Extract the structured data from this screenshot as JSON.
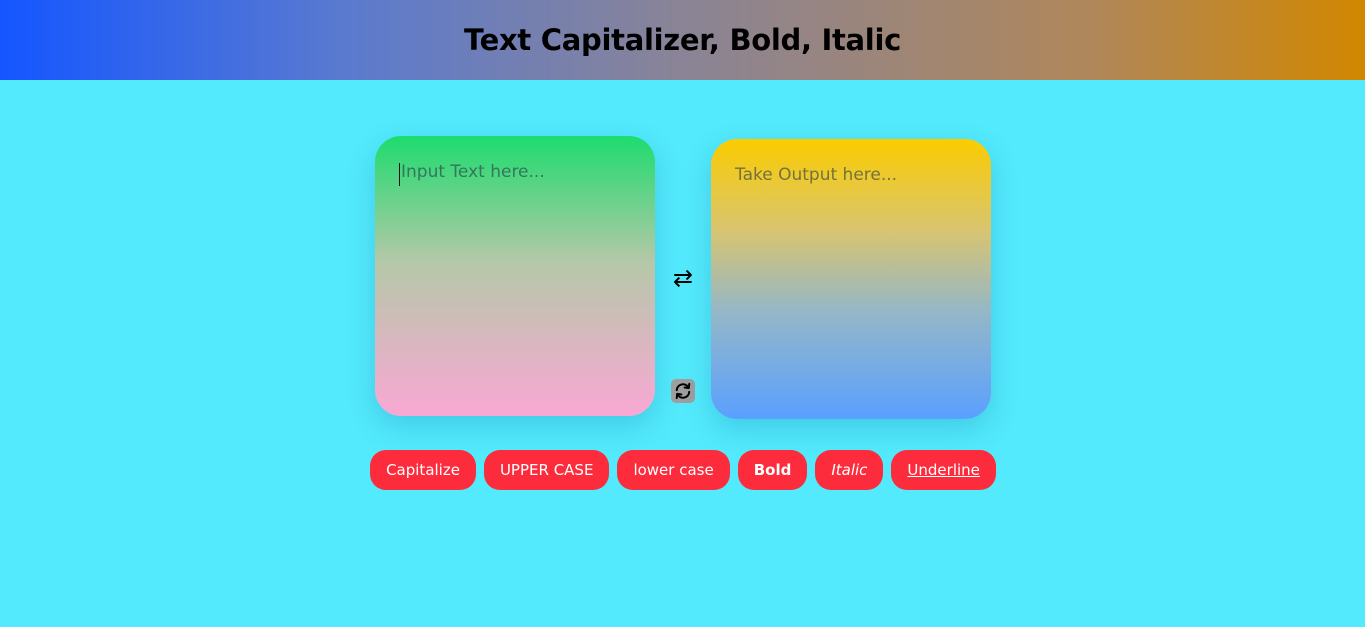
{
  "header": {
    "title": "Text Capitalizer, Bold, Italic"
  },
  "input": {
    "placeholder": "Input Text here...",
    "value": ""
  },
  "output": {
    "placeholder": "Take Output here...",
    "value": ""
  },
  "icons": {
    "swap": "⇄",
    "refresh": "refresh-icon"
  },
  "buttons": {
    "capitalize": "Capitalize",
    "uppercase": "UPPER CASE",
    "lowercase": "lower case",
    "bold": "Bold",
    "italic": "Italic",
    "underline": "Underline"
  },
  "colors": {
    "background": "#53eafd",
    "button": "#fd2c3c"
  }
}
